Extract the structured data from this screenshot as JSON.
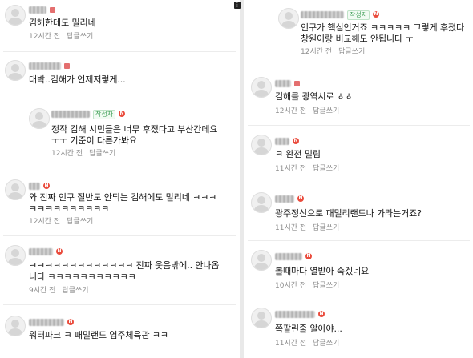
{
  "left": [
    {
      "text": "김해한테도 밀리네",
      "time": "12시간 전",
      "reply": "답글쓰기"
    },
    {
      "text": "대박..김해가 언제저렇게...",
      "time": "12시간 전",
      "reply": "답글쓰기"
    },
    {
      "badge": "작성자",
      "text": "정작 김해 시민들은 너무 후졌다고 부산간데요\nㅜㅜ 기준이 다른가봐요",
      "time": "12시간 전",
      "reply": "답글쓰기"
    },
    {
      "text": "와 진짜 인구 절반도 안되는 김해에도 밀리네 ㅋㅋㅋ\nㅋㅋㅋㅋㅋㅋㅋㅋㅋㅋ",
      "time": "12시간 전",
      "reply": "답글쓰기"
    },
    {
      "text": "ㅋㅋㅋㅋㅋㅋㅋㅋㅋㅋㅋㅋㅋ 진짜 웃음밖에.. 안나옵\n니다 ㅋㅋㅋㅋㅋㅋㅋㅋㅋㅋㅋ",
      "time": "9시간 전",
      "reply": "답글쓰기"
    },
    {
      "text": "워터파크 ㅋ 패밀랜드 염주체육관 ㅋㅋ",
      "time": "",
      "reply": ""
    }
  ],
  "right": [
    {
      "badge": "작성자",
      "text": "인구가 핵심인거죠 ㅋㅋㅋㅋㅋ 그렇게 후졌다\n창원이랑 비교해도 안됩니다 ㅜ",
      "time": "12시간 전",
      "reply": "답글쓰기"
    },
    {
      "text": "김해를 광역시로 ㅎㅎ",
      "time": "12시간 전",
      "reply": "답글쓰기"
    },
    {
      "text": "ㅋ 완전 밀림",
      "time": "11시간 전",
      "reply": "답글쓰기"
    },
    {
      "text": "광주정신으로 패밀리랜드나 가라는거죠?",
      "time": "11시간 전",
      "reply": "답글쓰기"
    },
    {
      "text": "볼때마다 열받아 죽겠네요",
      "time": "10시간 전",
      "reply": "답글쓰기"
    },
    {
      "text": "쪽팔린줄 알아야...",
      "time": "11시간 전",
      "reply": "답글쓰기"
    }
  ],
  "badges": {
    "n": "N",
    "more": "⋮"
  },
  "colors": {
    "author_badge": "#41a058",
    "n_badge": "#ea4b3c"
  }
}
